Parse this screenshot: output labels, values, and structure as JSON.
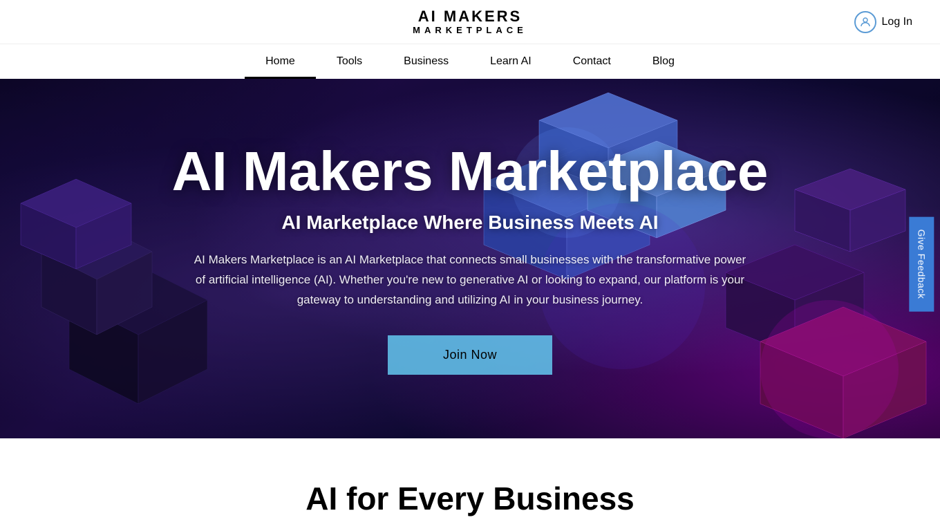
{
  "header": {
    "logo_title": "AI MAKERS",
    "logo_subtitle": "MARKETPLACE",
    "login_label": "Log In"
  },
  "nav": {
    "items": [
      {
        "label": "Home",
        "active": true
      },
      {
        "label": "Tools",
        "active": false
      },
      {
        "label": "Business",
        "active": false
      },
      {
        "label": "Learn AI",
        "active": false
      },
      {
        "label": "Contact",
        "active": false
      },
      {
        "label": "Blog",
        "active": false
      }
    ]
  },
  "hero": {
    "title": "AI Makers Marketplace",
    "subtitle": "AI Marketplace Where Business Meets AI",
    "description": "AI Makers Marketplace is an AI Marketplace that connects small businesses with the transformative power of artificial intelligence (AI). Whether you're new to generative AI or looking to expand, our platform is your gateway to understanding and utilizing AI in your business journey.",
    "cta_label": "Join Now"
  },
  "feedback": {
    "label": "Give Feedback"
  },
  "below_fold": {
    "title": "AI for Every Business"
  }
}
